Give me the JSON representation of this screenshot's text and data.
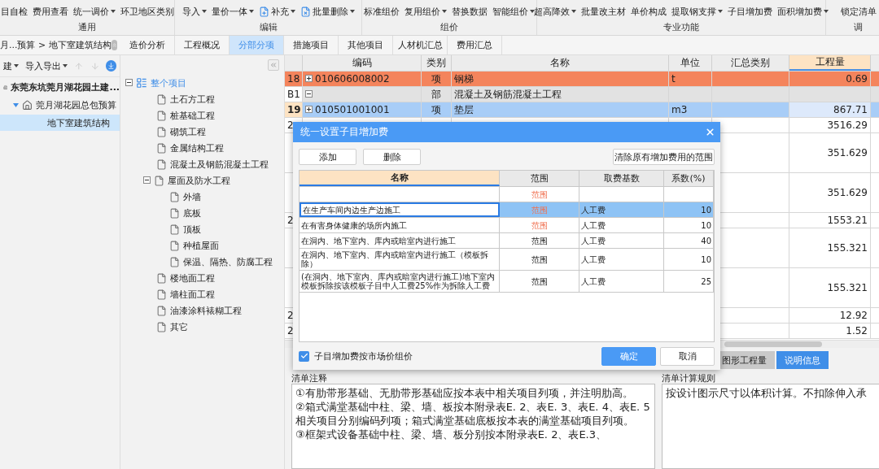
{
  "ribbon": {
    "groups": [
      {
        "label": "通用",
        "buttons": [
          {
            "label": "目自检",
            "dropdown": false
          },
          {
            "label": "费用查看",
            "dropdown": false
          },
          {
            "label": "统一调价",
            "dropdown": true
          },
          {
            "label": "环卫地区类别",
            "dropdown": false
          }
        ]
      },
      {
        "label": "编辑",
        "buttons": [
          {
            "label": "导入",
            "dropdown": true
          },
          {
            "label": "量价一体",
            "dropdown": true
          },
          {
            "label": "补充",
            "dropdown": true,
            "kind": "inline"
          },
          {
            "label": "批量删除",
            "dropdown": true,
            "kind": "inline"
          }
        ]
      },
      {
        "label": "组价",
        "buttons": [
          {
            "label": "标准组价",
            "dropdown": false
          },
          {
            "label": "复用组价",
            "dropdown": true
          },
          {
            "label": "替换数据",
            "dropdown": false
          },
          {
            "label": "智能组价",
            "dropdown": true
          }
        ]
      },
      {
        "label": "专业功能",
        "buttons": [
          {
            "label": "超高降效",
            "dropdown": true
          },
          {
            "label": "批量改主材",
            "dropdown": false
          },
          {
            "label": "单价构成",
            "dropdown": false
          },
          {
            "label": "提取钢支撑",
            "dropdown": true
          },
          {
            "label": "子目增加费",
            "dropdown": false
          },
          {
            "label": "面积增加费",
            "dropdown": true
          }
        ]
      },
      {
        "label": "调",
        "buttons": [
          {
            "label": "锁定清单",
            "dropdown": false
          }
        ]
      }
    ]
  },
  "breadcrumb": "月...预算 > 地下室建筑结构",
  "tabs": [
    {
      "label": "造价分析",
      "selected": false
    },
    {
      "label": "工程概况",
      "selected": false
    },
    {
      "label": "分部分项",
      "selected": true
    },
    {
      "label": "措施项目",
      "selected": false
    },
    {
      "label": "其他项目",
      "selected": false
    },
    {
      "label": "人材机汇总",
      "selected": false
    },
    {
      "label": "费用汇总",
      "selected": false
    }
  ],
  "project_panel": {
    "toolbar": [
      {
        "label": "建",
        "dropdown": true
      },
      {
        "label": "导入导出",
        "dropdown": true
      }
    ],
    "tree": [
      {
        "label": "东莞东坑莞月湖花园土建...",
        "kind": "project",
        "selected": false,
        "children": [
          {
            "label": "莞月湖花园总包预算",
            "kind": "budget",
            "selected": false,
            "expanded": true,
            "children": [
              {
                "label": "地下室建筑结构",
                "kind": "unit",
                "selected": true
              }
            ]
          }
        ]
      }
    ]
  },
  "section_tree": [
    {
      "label": "整个项目",
      "expanded": true,
      "selected": true,
      "children": [
        {
          "label": "土石方工程"
        },
        {
          "label": "桩基础工程"
        },
        {
          "label": "砌筑工程"
        },
        {
          "label": "金属结构工程"
        },
        {
          "label": "混凝土及钢筋混凝土工程"
        },
        {
          "label": "屋面及防水工程",
          "expanded": true,
          "children": [
            {
              "label": "外墙"
            },
            {
              "label": "底板"
            },
            {
              "label": "顶板"
            },
            {
              "label": "种植屋面"
            },
            {
              "label": "保温、隔热、防腐工程"
            }
          ]
        },
        {
          "label": "楼地面工程"
        },
        {
          "label": "墙柱面工程"
        },
        {
          "label": "油漆涂料裱糊工程"
        },
        {
          "label": "其它"
        }
      ]
    }
  ],
  "grid": {
    "columns": [
      {
        "label": "编码",
        "selected": false
      },
      {
        "label": "类别",
        "selected": false
      },
      {
        "label": "名称",
        "selected": false
      },
      {
        "label": "单位",
        "selected": false
      },
      {
        "label": "汇总类别",
        "selected": false
      },
      {
        "label": "工程量",
        "selected": true
      }
    ],
    "rows": [
      {
        "kind": "item",
        "number": "18",
        "code": "010606008002",
        "type": "项",
        "name": "钢梯",
        "unit": "t",
        "quantity": "0.69",
        "expanded": false,
        "highlighted": true,
        "selected": false
      },
      {
        "kind": "division",
        "number": "B1",
        "type": "部",
        "name": "混凝土及钢筋混凝土工程",
        "expanded": true,
        "highlighted": false,
        "selected": false
      },
      {
        "kind": "item",
        "number": "19",
        "code": "010501001001",
        "type": "项",
        "name": "垫层",
        "unit": "m3",
        "quantity": "867.71",
        "expanded": false,
        "highlighted": false,
        "selected": true
      },
      {
        "kind": "item",
        "number": "2",
        "quantity": "3516.29",
        "highlighted": false,
        "selected": false
      },
      {
        "kind": "sub",
        "quantity": "351.629",
        "highlighted": false,
        "selected": false
      },
      {
        "kind": "sub",
        "quantity": "351.629",
        "highlighted": false,
        "selected": false
      },
      {
        "kind": "item",
        "number": "2",
        "quantity": "1553.21",
        "highlighted": false,
        "selected": false
      },
      {
        "kind": "sub",
        "quantity": "155.321",
        "highlighted": false,
        "selected": false
      },
      {
        "kind": "sub",
        "quantity": "155.321",
        "highlighted": false,
        "selected": false
      },
      {
        "kind": "item",
        "number": "2",
        "quantity": "12.92",
        "highlighted": false,
        "selected": false
      },
      {
        "kind": "item",
        "number": "2",
        "quantity": "1.52",
        "highlighted": false,
        "selected": false
      }
    ]
  },
  "bottom_tabs": [
    {
      "label": "图形工程量",
      "selected": false
    },
    {
      "label": "说明信息",
      "selected": true
    }
  ],
  "notes": {
    "label": "清单注释",
    "text": "①有肋带形基础、无肋带形基础应按本表中相关项目列项，并注明肋高。\n②箱式满堂基础中柱、梁、墙、板按本附录表E. 2、表E. 3、表E. 4、表E. 5相关项目分别编码列项；箱式满堂基础底板按本表的满堂基础项目列项。\n③框架式设备基础中柱、梁、墙、板分别按本附录表E. 2、表E.3、"
  },
  "rules": {
    "label": "清单计算规则",
    "text": "按设计图示尺寸以体积计算。不扣除伸入承"
  },
  "dialog": {
    "title": "统一设置子目增加费",
    "buttons": [
      "添加",
      "删除"
    ],
    "clear_button": "清除原有增加费用的范围",
    "columns": [
      {
        "label": "名称",
        "selected": true
      },
      {
        "label": "范围",
        "selected": false
      },
      {
        "label": "取费基数",
        "selected": false
      },
      {
        "label": "系数(%)",
        "selected": false
      }
    ],
    "rows": [
      {
        "name": "",
        "scope": "范围",
        "scope_set": false,
        "base": "",
        "factor": "",
        "selected": false
      },
      {
        "name": "在生产车间内边生产边施工",
        "scope": "范围",
        "scope_set": false,
        "base": "人工费",
        "factor": "10",
        "selected": true
      },
      {
        "name": "在有害身体健康的场所内施工",
        "scope": "范围",
        "scope_set": false,
        "base": "人工费",
        "factor": "10",
        "selected": false
      },
      {
        "name": "在洞内、地下室内、库内或暗室内进行施工",
        "scope": "范围",
        "scope_set": true,
        "base": "人工费",
        "factor": "40",
        "selected": false
      },
      {
        "name": "在洞内、地下室内、库内或暗室内进行施工（模板拆除）",
        "scope": "范围",
        "scope_set": true,
        "base": "人工费",
        "factor": "10",
        "selected": false
      },
      {
        "name": "(在洞内、地下室内、库内或暗室内进行施工)地下室内模板拆除按该模板子目中人工费25%作为拆除人工费",
        "scope": "范围",
        "scope_set": true,
        "base": "人工费",
        "factor": "25",
        "selected": false
      }
    ],
    "checkbox": {
      "label": "子目增加费按市场价组价",
      "checked": true
    },
    "ok": "确定",
    "cancel": "取消"
  }
}
